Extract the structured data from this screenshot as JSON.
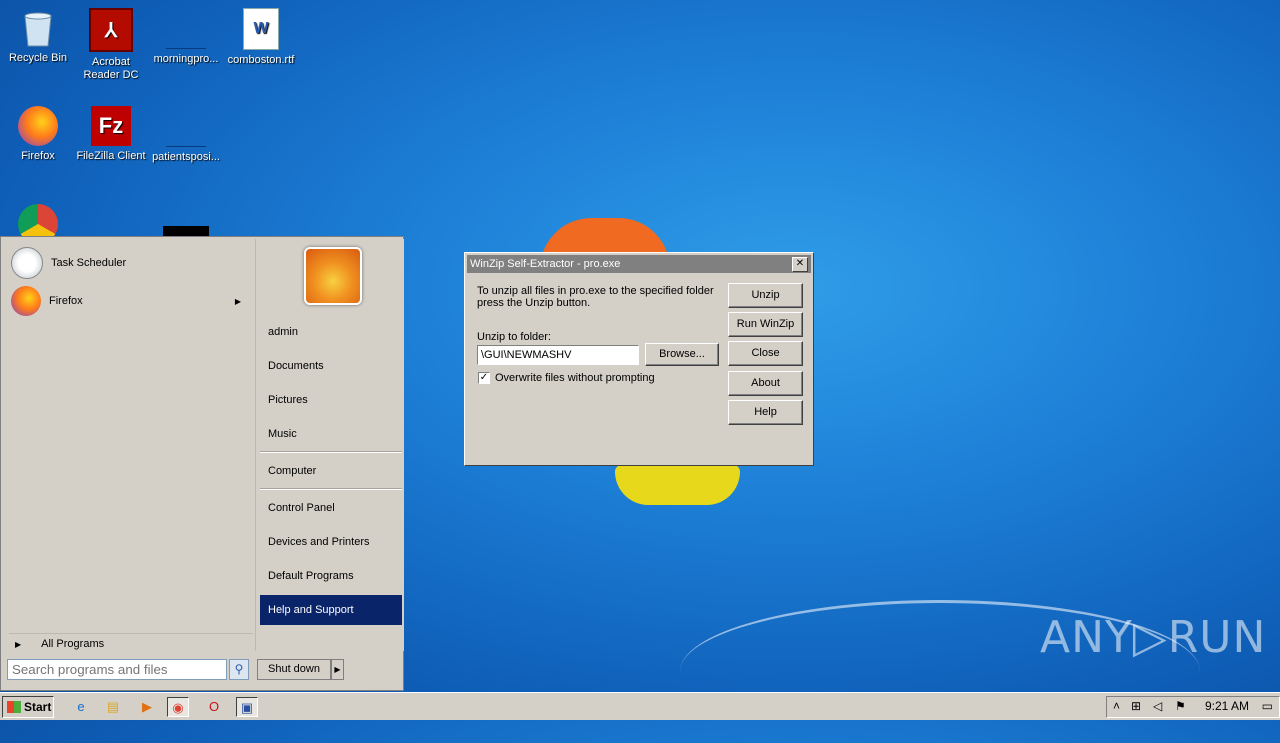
{
  "desktop": {
    "icons": [
      {
        "label": "Recycle Bin",
        "icon": "recycle-bin-icon"
      },
      {
        "label": "Acrobat Reader DC",
        "icon": "acrobat-icon"
      },
      {
        "label": "morningpro...",
        "icon": "file-icon"
      },
      {
        "label": "comboston.rtf",
        "icon": "word-doc-icon"
      },
      {
        "label": "Firefox",
        "icon": "firefox-icon"
      },
      {
        "label": "FileZilla Client",
        "icon": "filezilla-icon"
      },
      {
        "label": "patientsposi...",
        "icon": "file-icon"
      }
    ],
    "watermark": "ANY▷RUN"
  },
  "start_menu": {
    "pinned": [
      {
        "label": "Task Scheduler",
        "icon": "clock-icon"
      },
      {
        "label": "Firefox",
        "icon": "firefox-icon"
      }
    ],
    "all_programs": "All Programs",
    "search_placeholder": "Search programs and files",
    "right_links": [
      "admin",
      "Documents",
      "Pictures",
      "Music",
      "Computer",
      "Control Panel",
      "Devices and Printers",
      "Default Programs",
      "Help and Support"
    ],
    "selected": "Help and Support",
    "shutdown": "Shut down"
  },
  "dialog": {
    "title": "WinZip Self-Extractor - pro.exe",
    "message_line1": "To unzip all files in pro.exe to the specified folder",
    "message_line2": "press the Unzip button.",
    "folder_label": "Unzip to folder:",
    "folder_value": "\\GUI\\NEWMASHV",
    "browse": "Browse...",
    "checkbox_label": "Overwrite files without prompting",
    "checkbox_checked": true,
    "buttons": [
      "Unzip",
      "Run WinZip",
      "Close",
      "About",
      "Help"
    ]
  },
  "taskbar": {
    "start_label": "Start",
    "clock": "9:21 AM",
    "apps": [
      "ie-icon",
      "explorer-icon",
      "media-player-icon",
      "chrome-icon",
      "opera-icon",
      "winzip-icon"
    ]
  }
}
